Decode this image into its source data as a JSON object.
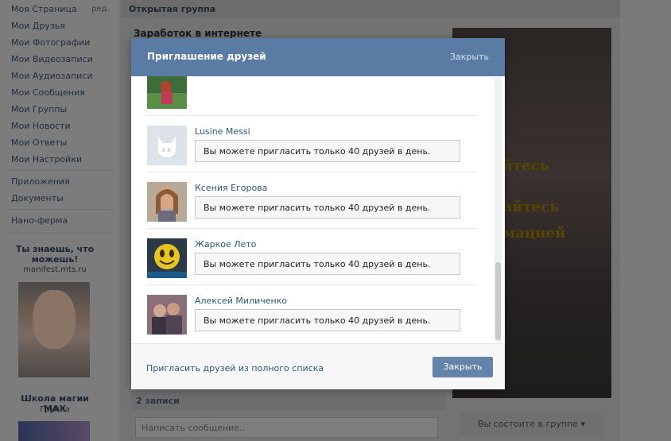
{
  "sidebar": {
    "items": [
      {
        "label": "Моя Страница"
      },
      {
        "label": "Мои Друзья"
      },
      {
        "label": "Мои Фотографии"
      },
      {
        "label": "Мои Видеозаписи"
      },
      {
        "label": "Мои Аудиозаписи"
      },
      {
        "label": "Мои Сообщения"
      },
      {
        "label": "Мои Группы"
      },
      {
        "label": "Мои Новости"
      },
      {
        "label": "Мои Ответы"
      },
      {
        "label": "Мои Настройки"
      },
      {
        "label": "Приложения"
      },
      {
        "label": "Документы"
      },
      {
        "label": "Нано-ферма"
      }
    ],
    "edit_label": "ред.",
    "ad1": {
      "title": "Ты знаешь, что можешь!",
      "domain": "manifest.mts.ru"
    },
    "ad2": {
      "title": "Школа магии MAX",
      "subtitle": "Группа"
    }
  },
  "page": {
    "header": "Открытая группа",
    "group_name": "Заработок в интернете",
    "cover_lines": [
      "айтесь",
      "вайтесь",
      "рмацией"
    ],
    "records": "2 записи",
    "message_placeholder": "Написать сообщение..",
    "membership": "Вы состоите в группе"
  },
  "modal": {
    "title": "Приглашение друзей",
    "close_link": "Закрыть",
    "friends": [
      {
        "name": "",
        "status": ""
      },
      {
        "name": "Lusine Messi",
        "status": "Вы можете пригласить только 40 друзей в день."
      },
      {
        "name": "Ксения Егорова",
        "status": "Вы можете пригласить только 40 друзей в день."
      },
      {
        "name": "Жаркое Лето",
        "status": "Вы можете пригласить только 40 друзей в день."
      },
      {
        "name": "Алексей Миличенко",
        "status": "Вы можете пригласить только 40 друзей в день."
      }
    ],
    "footer_link": "Пригласить друзей из полного списка",
    "close_button": "Закрыть"
  },
  "colors": {
    "header_blue": "#597ba4",
    "link_blue": "#2b587a",
    "button_blue": "#6383a8"
  }
}
